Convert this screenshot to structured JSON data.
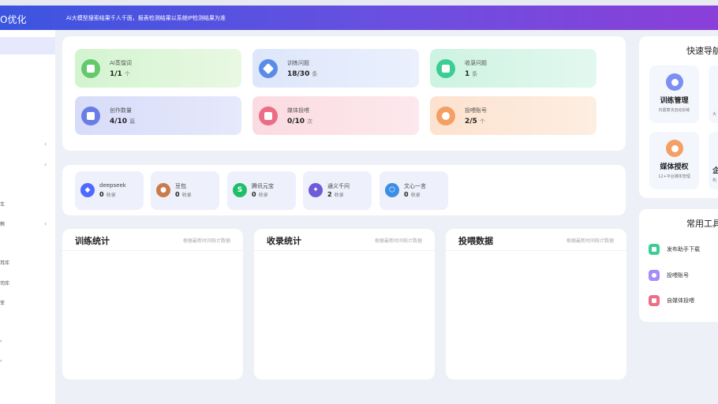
{
  "header": {
    "brand": "O优化",
    "notice": "Ai大模型搜索结果千人千面，报表检测结果以系统IP检测结果为准"
  },
  "sidebar": {
    "chevron": "‹",
    "fragments": [
      "车",
      "赖",
      "耳库",
      "司库",
      "菲",
      "›",
      "›"
    ]
  },
  "stats": [
    {
      "label": "AI蒸馏词",
      "value": "1/1",
      "unit": "个",
      "icon": "document-icon",
      "color": "#63c96b"
    },
    {
      "label": "训练问题",
      "value": "18/30",
      "unit": "条",
      "icon": "compass-icon",
      "color": "#5b8be8"
    },
    {
      "label": "收录问题",
      "value": "1",
      "unit": "条",
      "icon": "wallet-icon",
      "color": "#3ccd95"
    },
    {
      "label": "创作数量",
      "value": "4/10",
      "unit": "篇",
      "icon": "folder-icon",
      "color": "#6a7de6"
    },
    {
      "label": "媒体投喂",
      "value": "0/10",
      "unit": "次",
      "icon": "cart-icon",
      "color": "#ec6d86"
    },
    {
      "label": "投喂账号",
      "value": "2/5",
      "unit": "个",
      "icon": "user-icon",
      "color": "#f4a065"
    }
  ],
  "models": [
    {
      "name": "deepseek",
      "count": "0",
      "unit": "收录",
      "icon": "deepseek-whale-icon",
      "color": "#4d6bfe",
      "glyph": "◆"
    },
    {
      "name": "豆包",
      "count": "0",
      "unit": "收录",
      "icon": "doubao-avatar-icon",
      "color": "#c97b4b",
      "glyph": "●"
    },
    {
      "name": "腾讯元宝",
      "count": "0",
      "unit": "收录",
      "icon": "yuanbao-icon",
      "color": "#1fbf6a",
      "glyph": "S"
    },
    {
      "name": "通义千问",
      "count": "2",
      "unit": "收录",
      "icon": "tongyi-icon",
      "color": "#6f5bd8",
      "glyph": "✦"
    },
    {
      "name": "文心一言",
      "count": "0",
      "unit": "收录",
      "icon": "wenxin-icon",
      "color": "#3a8ee6",
      "glyph": "⬡"
    }
  ],
  "charts": [
    {
      "title": "训练统计",
      "subtitle": "根据最新时间统计数据"
    },
    {
      "title": "收录统计",
      "subtitle": "根据最新时间统计数据"
    },
    {
      "title": "投喂数据",
      "subtitle": "根据最新时间统计数据"
    }
  ],
  "quick_nav": {
    "title": "快速导航",
    "items": [
      {
        "label": "训练管理",
        "sub": "内置算法自动训练",
        "icon": "cloud-icon",
        "color": "#7d8ff0"
      },
      {
        "label": "媒体授权",
        "sub": "12+平台媒体管理",
        "icon": "user-circle-icon",
        "color": "#f4a065"
      }
    ],
    "fragments": [
      "大",
      "企",
      "构"
    ]
  },
  "tools": {
    "title": "常用工具",
    "items": [
      {
        "label": "发布助手下载",
        "icon": "clipboard-icon",
        "color": "#3ccd95"
      },
      {
        "label": "投喂账号",
        "icon": "account-icon",
        "color": "#a78bfa"
      },
      {
        "label": "自媒体投喂",
        "icon": "media-icon",
        "color": "#ec6d86"
      }
    ]
  }
}
